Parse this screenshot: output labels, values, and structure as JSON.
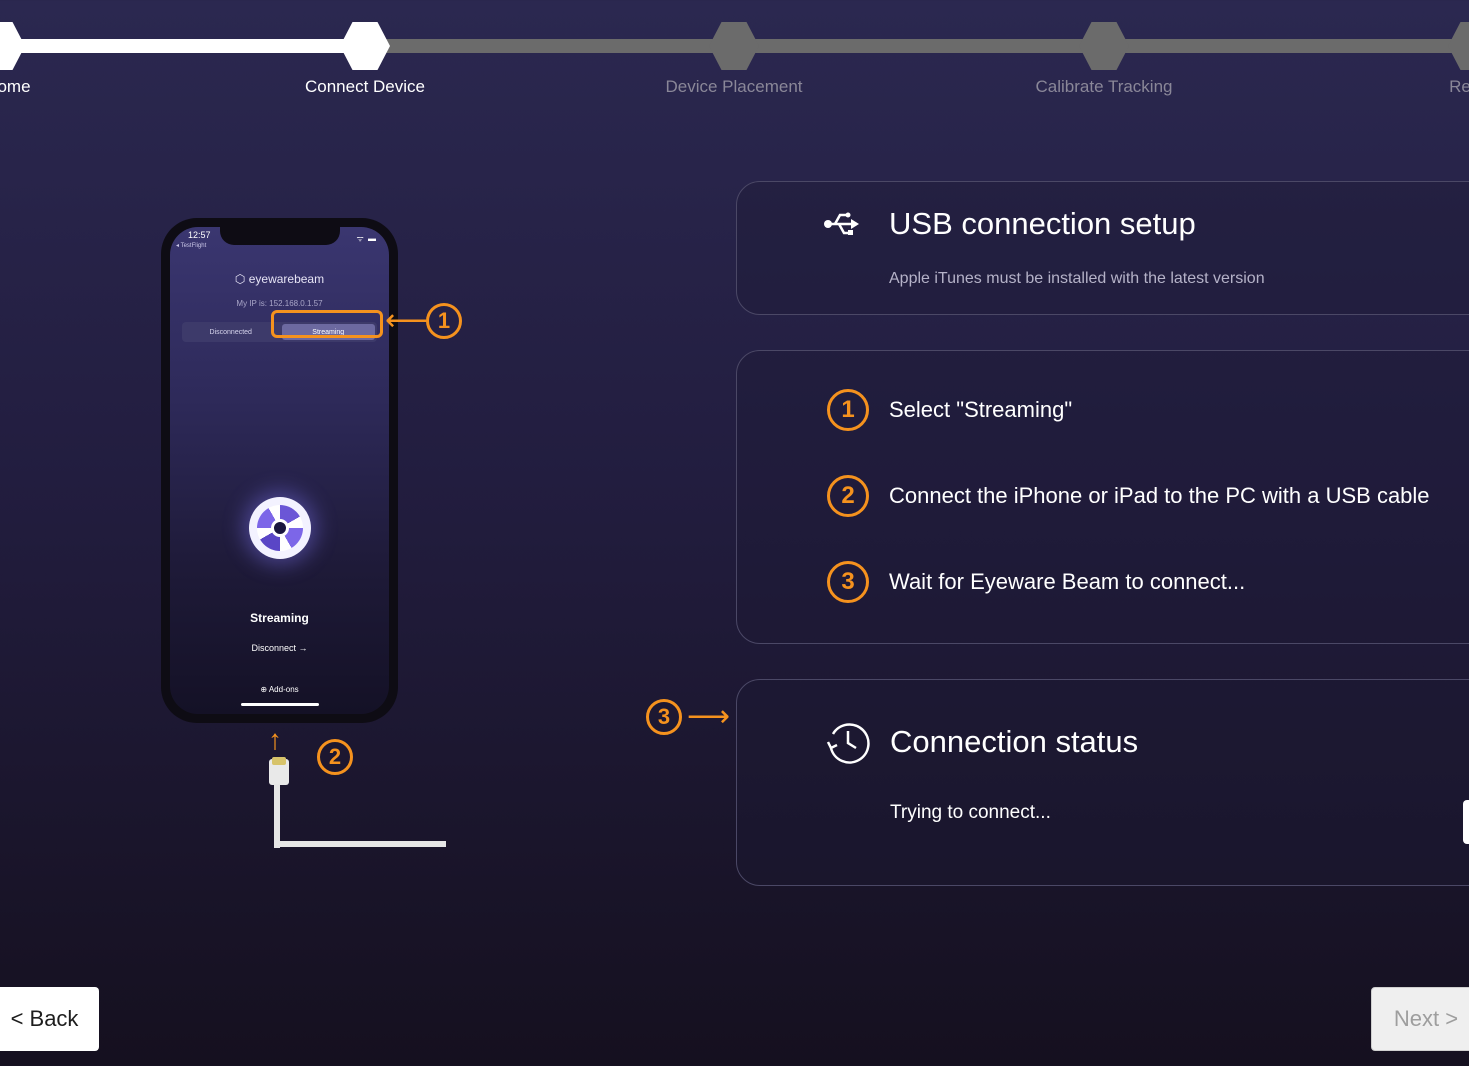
{
  "stepper": {
    "steps": [
      {
        "label": "ome",
        "state": "done"
      },
      {
        "label": "Connect Device",
        "state": "active"
      },
      {
        "label": "Device Placement",
        "state": "todo"
      },
      {
        "label": "Calibrate Tracking",
        "state": "todo"
      },
      {
        "label": "Re",
        "state": "todo"
      }
    ]
  },
  "phone": {
    "time": "12:57",
    "back_label": "◂ TestFlight",
    "status_icons": "ᯤ ▬",
    "brand": "⬡ eyewarebeam",
    "ip_label": "My IP is: 152.168.0.1.57",
    "segment": {
      "off_label": "Disconnected",
      "on_label": "Streaming"
    },
    "state_label": "Streaming",
    "disconnect_label": "Disconnect →",
    "addons_label": "⊕ Add-ons"
  },
  "annotations": {
    "one": "1",
    "two": "2",
    "three": "3",
    "arrow_left": "⟵",
    "arrow_up": "↑",
    "arrow_right": "⟶"
  },
  "usb_panel": {
    "title": "USB connection setup",
    "subtitle": "Apple iTunes must be installed with the latest version"
  },
  "steps_panel": {
    "items": [
      {
        "num": "1",
        "text": "Select \"Streaming\""
      },
      {
        "num": "2",
        "text": "Connect the iPhone or iPad to the PC with a USB cable"
      },
      {
        "num": "3",
        "text": "Wait for Eyeware Beam to connect..."
      }
    ]
  },
  "status_panel": {
    "title": "Connection status",
    "status": "Trying to connect..."
  },
  "buttons": {
    "back": "< Back",
    "next": "Next >"
  },
  "colors": {
    "accent": "#f5921e",
    "track_done": "#ffffff",
    "track_todo": "#6b6b6b"
  }
}
